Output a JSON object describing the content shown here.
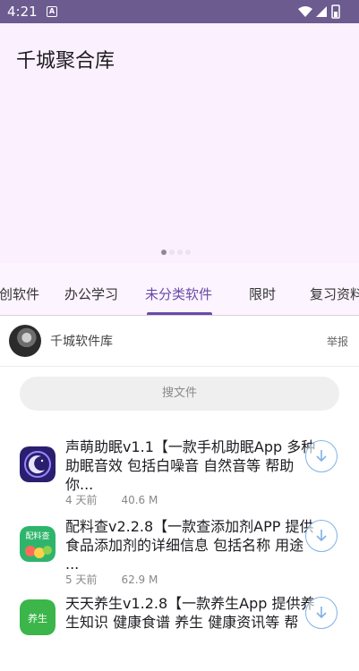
{
  "status_bar": {
    "time": "4:21",
    "notification_icon": "A"
  },
  "header": {
    "title": "千城聚合库"
  },
  "carousel": {
    "pages": 4,
    "active_index": 0
  },
  "tabs": [
    {
      "label": "创软件"
    },
    {
      "label": "办公学习"
    },
    {
      "label": "未分类软件",
      "selected": true
    },
    {
      "label": "限时"
    },
    {
      "label": "复习资料"
    }
  ],
  "author": {
    "name": "千城软件库",
    "report_label": "举报"
  },
  "search": {
    "placeholder": "搜文件"
  },
  "items": [
    {
      "title": "声萌助眠v1.1【一款手机助眠App 多种助眠音效 包括白噪音 自然音等 帮助你...",
      "date": "4 天前",
      "size": "40.6 M",
      "icon": "moon-icon"
    },
    {
      "title": "配料查v2.2.8【一款查添加剂APP 提供食品添加剂的详细信息 包括名称 用途 ...",
      "date": "5 天前",
      "size": "62.9 M",
      "icon": "ingredient-check-icon"
    },
    {
      "title": "天天养生v1.2.8【一款养生App 提供养生知识 健康食谱 养生 健康资讯等 帮",
      "date": "",
      "size": "",
      "icon": "health-icon"
    }
  ],
  "colors": {
    "accent": "#6a4aa8",
    "header_bg": "#fbf0fe",
    "status_bar": "#6b5b8f"
  }
}
